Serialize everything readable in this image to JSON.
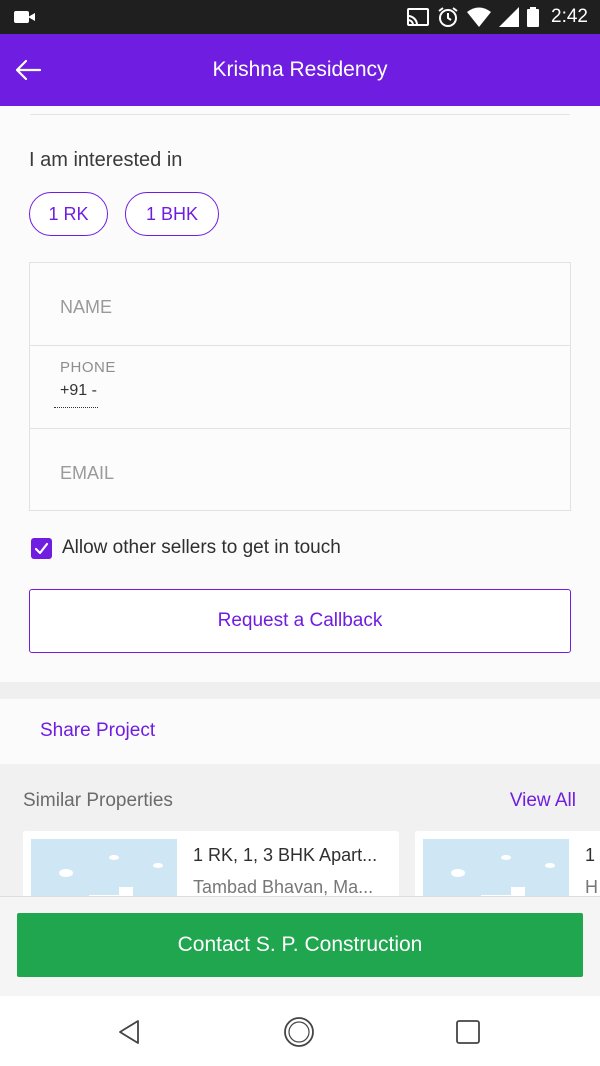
{
  "status_bar": {
    "time": "2:42",
    "icons": [
      "video-camera-icon",
      "cast-icon",
      "alarm-icon",
      "wifi-icon",
      "signal-icon",
      "battery-icon"
    ]
  },
  "app_bar": {
    "title": "Krishna Residency",
    "back_icon": "arrow-left-icon",
    "color": "#6f1de0"
  },
  "interest": {
    "label": "I am interested in",
    "options": [
      "1 RK",
      "1 BHK"
    ]
  },
  "form": {
    "name_placeholder": "NAME",
    "phone_label": "PHONE",
    "phone_value": "+91 -",
    "email_placeholder": "EMAIL"
  },
  "allow_sellers": {
    "label": "Allow other sellers to get in touch",
    "checked": true
  },
  "callback_button": "Request a Callback",
  "share_project": "Share Project",
  "similar": {
    "title": "Similar Properties",
    "view_all": "View All",
    "cards": [
      {
        "title": "1 RK, 1, 3 BHK Apart...",
        "subtitle": "Tambad Bhavan, Ma..."
      },
      {
        "title": "1",
        "subtitle": "H"
      }
    ]
  },
  "contact_button": "Contact S. P. Construction",
  "contact_color": "#1fa64f",
  "nav_bar": {
    "icons": [
      "back-triangle-icon",
      "home-circle-icon",
      "recents-square-icon"
    ]
  }
}
